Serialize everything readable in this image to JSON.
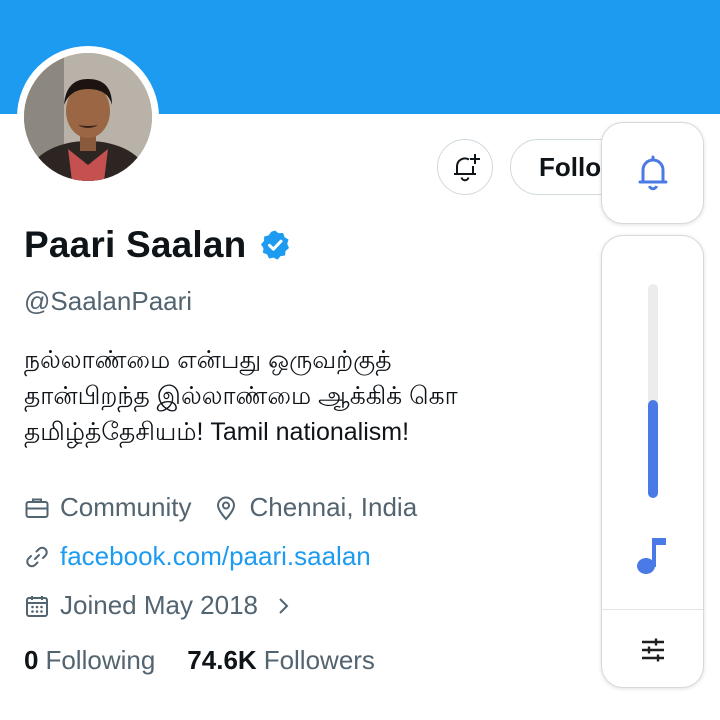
{
  "profile": {
    "display_name": "Paari Saalan",
    "handle": "@SaalanPaari",
    "bio_lines": [
      "நல்லாண்மை என்பது ஒருவற்குத்",
      "தான்பிறந்த இல்லாண்மை ஆக்கிக் கொ",
      "தமிழ்த்தேசியம்! Tamil nationalism!"
    ],
    "category": "Community",
    "location": "Chennai, India",
    "website": "facebook.com/paari.saalan",
    "joined": "Joined May 2018",
    "following_count": "0",
    "following_label": "Following",
    "followers_count": "74.6K",
    "followers_label": "Followers"
  },
  "actions": {
    "follow_label": "Follo",
    "notify_icon": "bell-plus-icon"
  },
  "volume_overlay": {
    "level": 0.46,
    "stream_icon": "music-note-icon",
    "ringer_icon": "bell-icon",
    "settings_icon": "equalizer-icon"
  },
  "colors": {
    "banner": "#1d9bf0",
    "link": "#1d9bf0",
    "verified": "#1d9bf0",
    "volume_accent": "#4a7ae6",
    "secondary_text": "#536471"
  }
}
